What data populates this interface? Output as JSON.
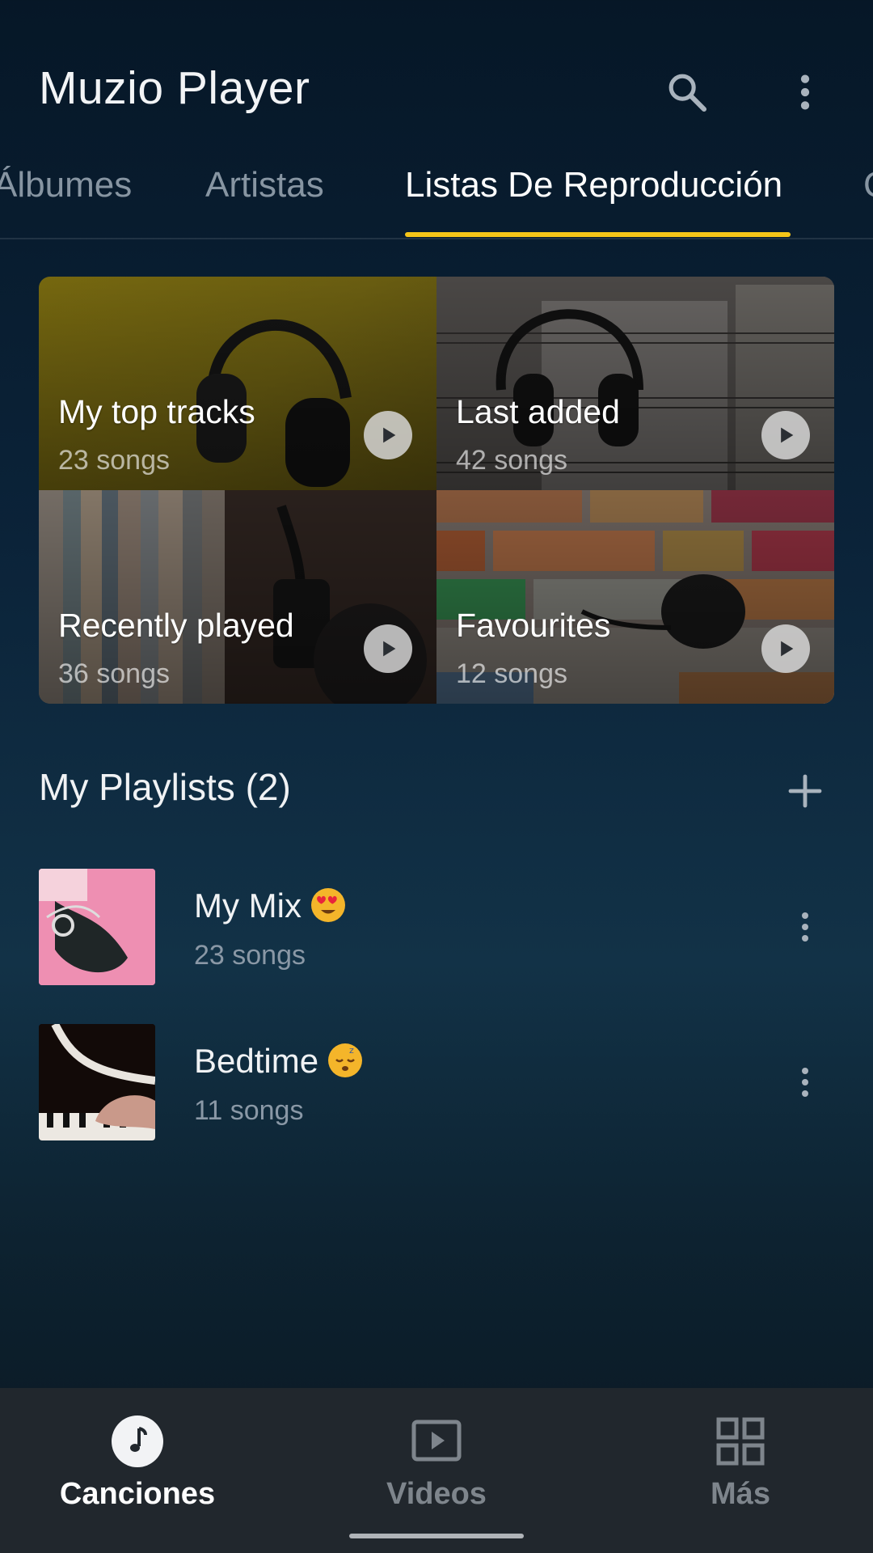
{
  "app": {
    "title": "Muzio Player"
  },
  "tabs": [
    {
      "label": "Álbumes",
      "active": false
    },
    {
      "label": "Artistas",
      "active": false
    },
    {
      "label": "Listas De Reproducción",
      "active": true
    },
    {
      "label": "C",
      "active": false
    }
  ],
  "smart_playlists": [
    {
      "name": "My top tracks",
      "count": "23 songs"
    },
    {
      "name": "Last added",
      "count": "42 songs"
    },
    {
      "name": "Recently played",
      "count": "36 songs"
    },
    {
      "name": "Favourites",
      "count": "12 songs"
    }
  ],
  "my_playlists": {
    "title": "My Playlists (2)",
    "items": [
      {
        "name": "My Mix",
        "emoji": "heart-eyes-emoji",
        "count": "23 songs"
      },
      {
        "name": "Bedtime",
        "emoji": "sleeping-face-emoji",
        "count": "11 songs"
      }
    ]
  },
  "bottom_nav": [
    {
      "label": "Canciones",
      "icon": "music-note-icon",
      "active": true
    },
    {
      "label": "Videos",
      "icon": "video-play-icon",
      "active": false
    },
    {
      "label": "Más",
      "icon": "grid-icon",
      "active": false
    }
  ],
  "colors": {
    "accent": "#f5c518",
    "background": "#0b2339",
    "nav_bg": "#21272d"
  }
}
